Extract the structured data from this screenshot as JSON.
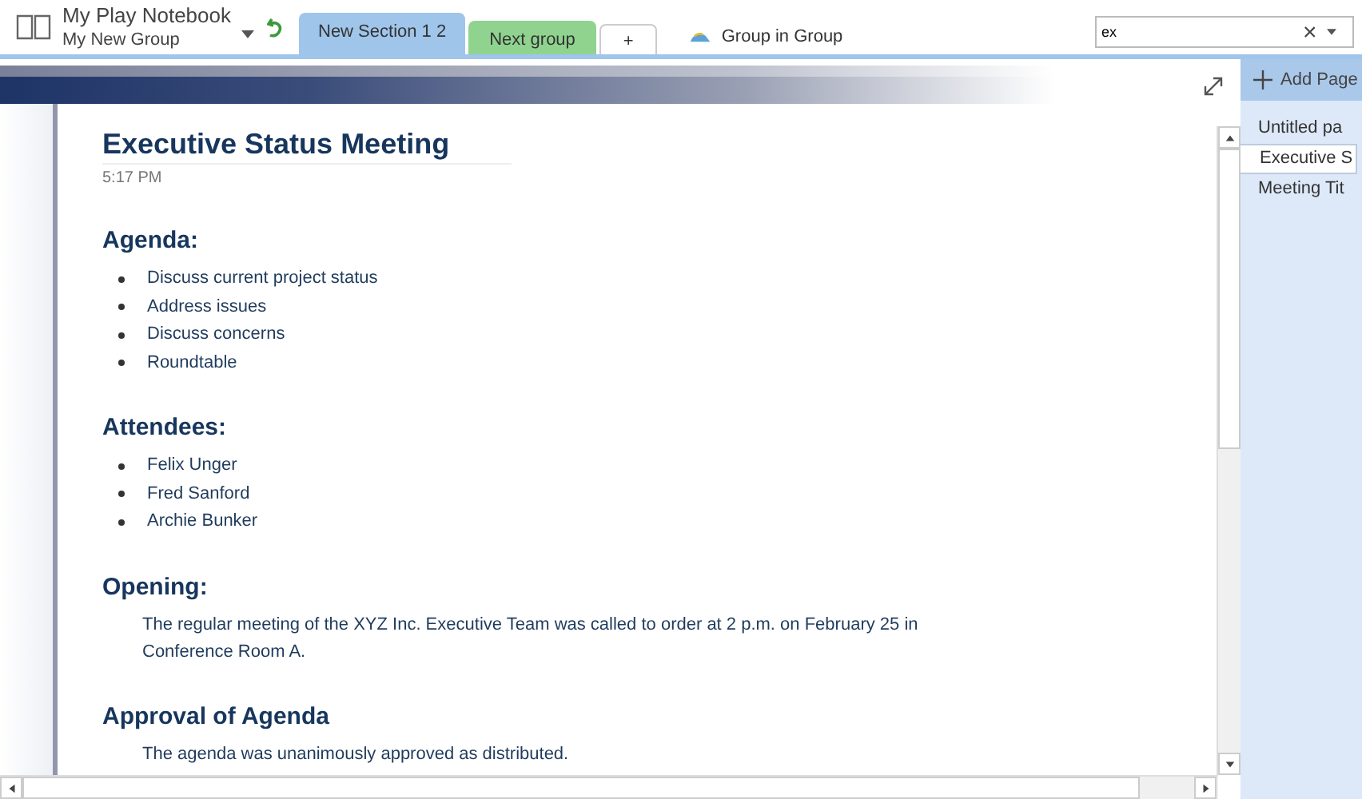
{
  "notebook": {
    "name": "My Play Notebook",
    "group": "My New Group"
  },
  "sections": [
    {
      "kind": "tab",
      "label": "New Section 1 2",
      "color": "#9fc5ea",
      "selected": true
    },
    {
      "kind": "tab",
      "label": "Next group",
      "color": "#8fd38f",
      "selected": false
    },
    {
      "kind": "add",
      "label": "+",
      "selected": false
    },
    {
      "kind": "group",
      "label": "Group in Group",
      "selected": false
    }
  ],
  "search": {
    "value": "ex",
    "clear": "×"
  },
  "page": {
    "title": "Executive Status Meeting",
    "time": "5:17 PM",
    "blocks": [
      {
        "kind": "heading",
        "text": "Agenda:"
      },
      {
        "kind": "bullets",
        "items": [
          "Discuss current project status",
          "Address issues",
          "Discuss concerns",
          "Roundtable"
        ]
      },
      {
        "kind": "heading",
        "text": "Attendees:"
      },
      {
        "kind": "bullets",
        "items": [
          "Felix Unger",
          "Fred Sanford",
          "Archie Bunker"
        ]
      },
      {
        "kind": "heading",
        "text": "Opening:"
      },
      {
        "kind": "paragraph",
        "text": "The regular meeting of the XYZ Inc. Executive Team was called to order at 2 p.m. on February 25 in Conference Room A."
      },
      {
        "kind": "heading",
        "text": "Approval of Agenda"
      },
      {
        "kind": "paragraph",
        "text": "The agenda was unanimously approved as distributed."
      }
    ]
  },
  "pages_pane": {
    "add_label": "Add Page",
    "pages": [
      {
        "title": "Untitled pa",
        "selected": false
      },
      {
        "title": "Executive S",
        "selected": true
      },
      {
        "title": "Meeting Tit",
        "selected": false
      }
    ]
  }
}
